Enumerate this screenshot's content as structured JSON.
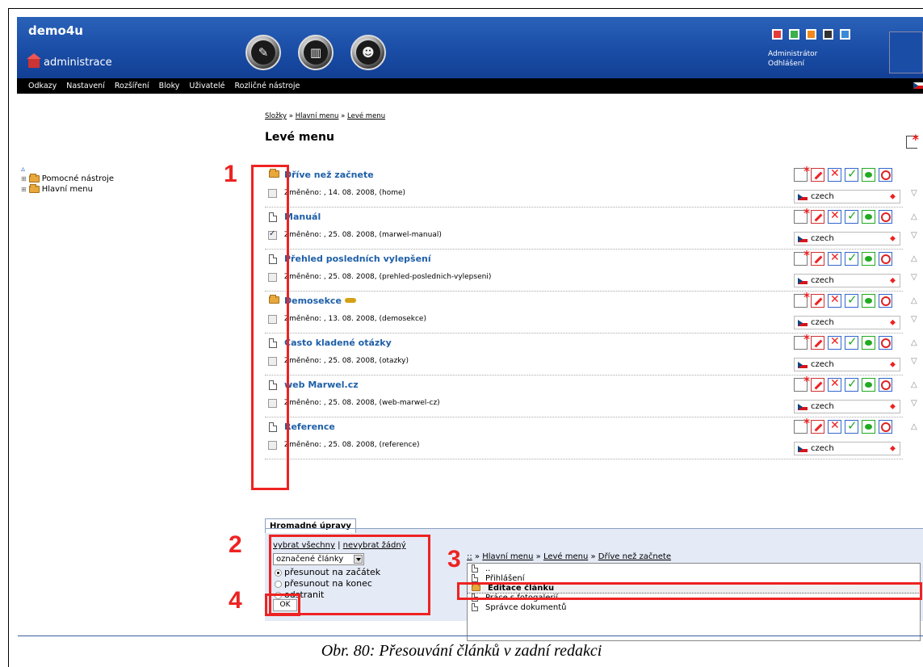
{
  "header": {
    "site_title": "demo4u",
    "admin_label": "administrace",
    "user_name": "Administrátor",
    "logout": "Odhlášení",
    "color_squares": [
      "#e23b3b",
      "#3bb04a",
      "#f08a1e",
      "#333333",
      "#3a8ad8"
    ]
  },
  "menu": [
    "Odkazy",
    "Nastavení",
    "Rozšíření",
    "Bloky",
    "Uživatelé",
    "Rozličné nástroje"
  ],
  "tree": {
    "items": [
      "Pomocné nástroje",
      "Hlavní menu"
    ]
  },
  "breadcrumb": [
    "Složky",
    "Hlavní menu",
    "Levé menu"
  ],
  "breadcrumb_sep": " » ",
  "page_title": "Levé menu",
  "articles": [
    {
      "title": "Dříve než začnete",
      "type": "folder",
      "meta": "Změněno: , 14. 08. 2008, (home)",
      "checked": false,
      "lang": "czech",
      "up": false,
      "down": true
    },
    {
      "title": "Manuál",
      "type": "doc",
      "meta": "Změněno: , 25. 08. 2008, (marwel-manual)",
      "checked": true,
      "lang": "czech",
      "up": true,
      "down": true
    },
    {
      "title": "Přehled posledních vylepšení",
      "type": "doc",
      "meta": "Změněno: , 25. 08. 2008, (prehled-poslednich-vylepseni)",
      "checked": false,
      "lang": "czech",
      "up": true,
      "down": true
    },
    {
      "title": "Demosekce",
      "type": "folder",
      "locked": true,
      "meta": "Změněno: , 13. 08. 2008, (demosekce)",
      "checked": false,
      "lang": "czech",
      "up": true,
      "down": true
    },
    {
      "title": "Často kladené otázky",
      "type": "doc",
      "meta": "Změněno: , 25. 08. 2008, (otazky)",
      "checked": false,
      "lang": "czech",
      "up": true,
      "down": true
    },
    {
      "title": "web Marwel.cz",
      "type": "doc",
      "meta": "Změněno: , 25. 08. 2008, (web-marwel-cz)",
      "checked": false,
      "lang": "czech",
      "up": true,
      "down": true
    },
    {
      "title": "Reference",
      "type": "doc",
      "meta": "Změněno: , 25. 08. 2008, (reference)",
      "checked": false,
      "lang": "czech",
      "up": true,
      "down": false
    }
  ],
  "bulk": {
    "tab_label": "Hromadné úpravy",
    "select_all": "vybrat všechny",
    "sep": "|",
    "select_none": "nevybrat žádný",
    "select_value": "označené články",
    "radios": [
      {
        "label": "přesunout na začátek",
        "checked": true
      },
      {
        "label": "přesunout na konec",
        "checked": false
      },
      {
        "label": "odstranit",
        "checked": false
      }
    ],
    "ok": "OK"
  },
  "target": {
    "root": "::",
    "path": [
      "Hlavní menu",
      "Levé menu",
      "Dříve než začnete"
    ],
    "sep": " » ",
    "items": [
      {
        "label": "..",
        "type": "doc"
      },
      {
        "label": "Přihlášení",
        "type": "doc"
      },
      {
        "label": "Editace článku",
        "type": "folder",
        "selected": true
      },
      {
        "label": "Práce s fotogalerií",
        "type": "doc"
      },
      {
        "label": "Správce dokumentů",
        "type": "doc"
      }
    ]
  },
  "annotations": [
    "1",
    "2",
    "3",
    "4"
  ],
  "caption": "Obr. 80: Přesouvání článků v zadní redakci"
}
